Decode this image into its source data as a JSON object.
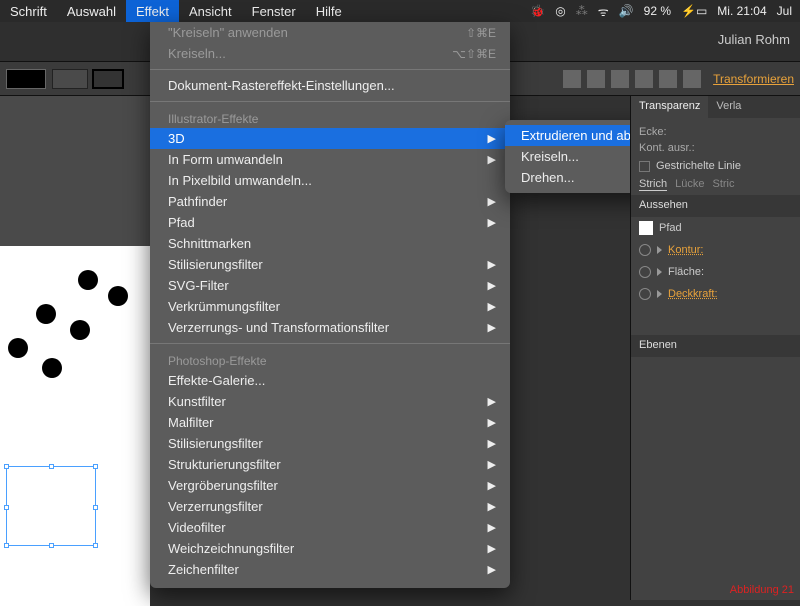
{
  "menubar": {
    "items": [
      "Schrift",
      "Auswahl",
      "Effekt",
      "Ansicht",
      "Fenster",
      "Hilfe"
    ],
    "active_index": 2,
    "status": {
      "battery": "92 %",
      "clock": "Mi. 21:04",
      "user_short": "Jul"
    }
  },
  "appbar": {
    "username": "Julian Rohm"
  },
  "toolbar": {
    "transform_label": "Transformieren"
  },
  "menu": {
    "recent_apply": "\"Kreiseln\" anwenden",
    "recent_apply_shortcut": "⇧⌘E",
    "recent": "Kreiseln...",
    "recent_shortcut": "⌥⇧⌘E",
    "raster_settings": "Dokument-Rastereffekt-Einstellungen...",
    "section1_header": "Illustrator-Effekte",
    "section1": [
      {
        "label": "3D",
        "arrow": true,
        "highlight": true
      },
      {
        "label": "In Form umwandeln",
        "arrow": true
      },
      {
        "label": "In Pixelbild umwandeln..."
      },
      {
        "label": "Pathfinder",
        "arrow": true
      },
      {
        "label": "Pfad",
        "arrow": true
      },
      {
        "label": "Schnittmarken"
      },
      {
        "label": "Stilisierungsfilter",
        "arrow": true
      },
      {
        "label": "SVG-Filter",
        "arrow": true
      },
      {
        "label": "Verkrümmungsfilter",
        "arrow": true
      },
      {
        "label": "Verzerrungs- und Transformationsfilter",
        "arrow": true
      }
    ],
    "section2_header": "Photoshop-Effekte",
    "section2": [
      {
        "label": "Effekte-Galerie..."
      },
      {
        "label": "Kunstfilter",
        "arrow": true
      },
      {
        "label": "Malfilter",
        "arrow": true
      },
      {
        "label": "Stilisierungsfilter",
        "arrow": true
      },
      {
        "label": "Strukturierungsfilter",
        "arrow": true
      },
      {
        "label": "Vergröberungsfilter",
        "arrow": true
      },
      {
        "label": "Verzerrungsfilter",
        "arrow": true
      },
      {
        "label": "Videofilter",
        "arrow": true
      },
      {
        "label": "Weichzeichnungsfilter",
        "arrow": true
      },
      {
        "label": "Zeichenfilter",
        "arrow": true
      }
    ]
  },
  "submenu": {
    "items": [
      {
        "label": "Extrudieren und abgeflachte Kante...",
        "highlight": true
      },
      {
        "label": "Kreiseln..."
      },
      {
        "label": "Drehen..."
      }
    ]
  },
  "panels": {
    "tabs_top": [
      "Transparenz",
      "Verla"
    ],
    "ecke_label": "Ecke:",
    "kont_label": "Kont. ausr.:",
    "dash_label": "Gestrichelte Linie",
    "stroke_tabs": [
      "Strich",
      "Lücke",
      "Stric"
    ],
    "appearance_header": "Aussehen",
    "appearance_path": "Pfad",
    "appearance_items": [
      {
        "name": "Kontur:",
        "link": true
      },
      {
        "name": "Fläche:"
      },
      {
        "name": "Deckkraft:",
        "link": true
      }
    ],
    "layers_header": "Ebenen"
  },
  "footer_text": "Abbildung  21"
}
